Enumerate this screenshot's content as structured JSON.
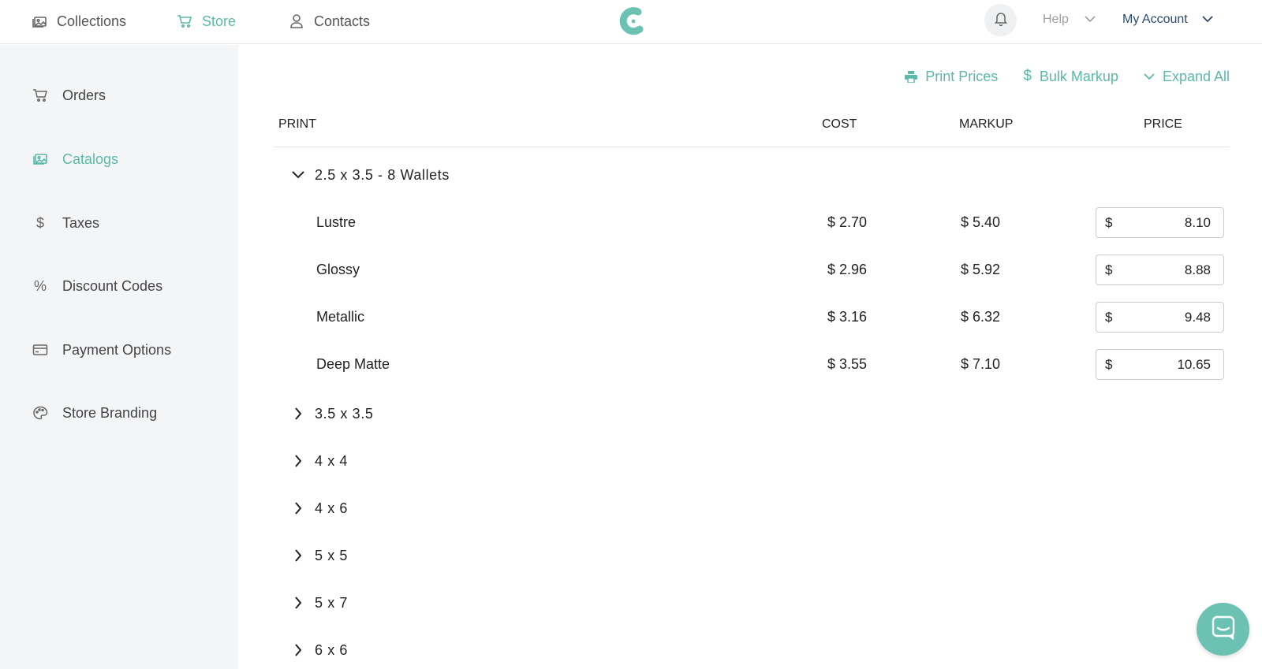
{
  "topnav": {
    "items": [
      {
        "label": "Collections",
        "icon": "collections-icon"
      },
      {
        "label": "Store",
        "icon": "cart-icon"
      },
      {
        "label": "Contacts",
        "icon": "person-icon"
      }
    ],
    "help_label": "Help",
    "account_label": "My Account"
  },
  "colors": {
    "accent": "#5cb8a8",
    "sidebar_bg": "#f4f5f6",
    "account_text": "#2b4a6b"
  },
  "sidebar": {
    "items": [
      {
        "label": "Orders",
        "icon": "cart-icon"
      },
      {
        "label": "Catalogs",
        "icon": "catalog-icon"
      },
      {
        "label": "Taxes",
        "icon": "dollar-icon"
      },
      {
        "label": "Discount Codes",
        "icon": "percent-icon"
      },
      {
        "label": "Payment Options",
        "icon": "credit-card-icon"
      },
      {
        "label": "Store Branding",
        "icon": "palette-icon"
      }
    ]
  },
  "toolbar": {
    "print_prices": "Print Prices",
    "bulk_markup": "Bulk Markup",
    "expand_all": "Expand All"
  },
  "table": {
    "headers": {
      "print": "PRINT",
      "cost": "COST",
      "markup": "MARKUP",
      "price": "PRICE"
    },
    "expanded_group": {
      "label": "2.5 x 3.5 - 8 Wallets",
      "items": [
        {
          "name": "Lustre",
          "cost": "$ 2.70",
          "markup": "$ 5.40",
          "currency": "$",
          "price": "8.10"
        },
        {
          "name": "Glossy",
          "cost": "$ 2.96",
          "markup": "$ 5.92",
          "currency": "$",
          "price": "8.88"
        },
        {
          "name": "Metallic",
          "cost": "$ 3.16",
          "markup": "$ 6.32",
          "currency": "$",
          "price": "9.48"
        },
        {
          "name": "Deep Matte",
          "cost": "$ 3.55",
          "markup": "$ 7.10",
          "currency": "$",
          "price": "10.65"
        }
      ]
    },
    "collapsed_groups": [
      "3.5 x 3.5",
      "4 x 4",
      "4 x 6",
      "5 x 5",
      "5 x 7",
      "6 x 6"
    ]
  }
}
